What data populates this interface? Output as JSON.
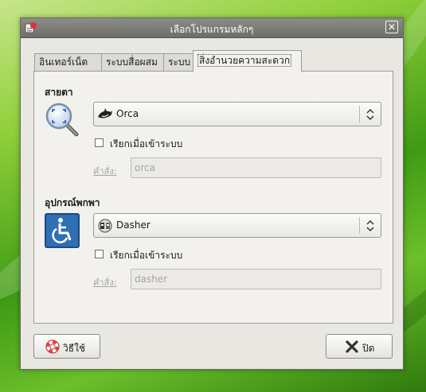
{
  "window": {
    "title": "เลือกโปรแกรมหลักๆ"
  },
  "tabs": [
    {
      "label": "อินเทอร์เน็ต",
      "active": false
    },
    {
      "label": "ระบบสื่อผสม",
      "active": false
    },
    {
      "label": "ระบบ",
      "active": false
    },
    {
      "label": "สิ่งอำนวยความสะดวก",
      "active": true
    }
  ],
  "visual": {
    "title": "สายตา",
    "application": "Orca",
    "start_on_login_label": "เรียกเมื่อเข้าระบบ",
    "start_on_login_checked": false,
    "command_label": "คำสั่ง:",
    "command_value": "orca"
  },
  "mobility": {
    "title": "อุปกรณ์พกพา",
    "application": "Dasher",
    "start_on_login_label": "เรียกเมื่อเข้าระบบ",
    "start_on_login_checked": false,
    "command_label": "คำสั่ง:",
    "command_value": "dasher"
  },
  "buttons": {
    "help": "วิธีใช้",
    "close": "ปิด"
  },
  "icons": {
    "app": "preferred-apps-icon",
    "visual": "magnifier-icon",
    "mobility": "wheelchair-icon",
    "orca": "orca-whale-icon",
    "dasher": "dasher-icon",
    "help": "lifebuoy-icon",
    "close": "x-icon"
  },
  "colors": {
    "accent": "#3a78c0",
    "titlebar": "#7a7a75",
    "background": "#5aa820"
  }
}
